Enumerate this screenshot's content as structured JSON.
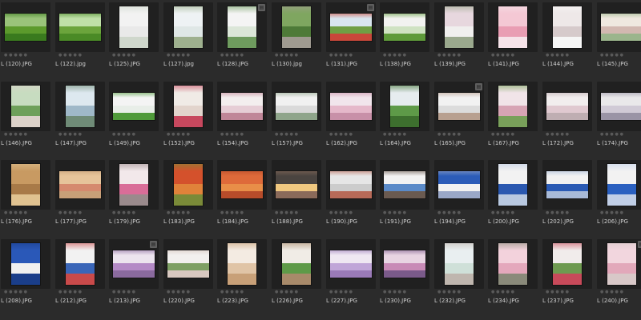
{
  "browser": {
    "items": [
      {
        "filename": "L (120).JPG",
        "orient": "l",
        "stacked": false,
        "stars": 0,
        "palette": [
          "#9ac37a",
          "#5c9a2c",
          "#3a7a1e"
        ]
      },
      {
        "filename": "L (122).jpg",
        "orient": "l",
        "stacked": false,
        "stars": 0,
        "palette": [
          "#bfe0a8",
          "#6ba43c",
          "#4a8a26"
        ]
      },
      {
        "filename": "L (125).JPG",
        "orient": "p",
        "stacked": false,
        "stars": 0,
        "palette": [
          "#f2f2f2",
          "#e9e9e9",
          "#cfd7cc"
        ]
      },
      {
        "filename": "L (127).jpg",
        "orient": "p",
        "stacked": false,
        "stars": 0,
        "palette": [
          "#eef2f4",
          "#dfe7e6",
          "#9eb08e"
        ]
      },
      {
        "filename": "L (128).JPG",
        "orient": "p",
        "stacked": true,
        "stars": 0,
        "palette": [
          "#f4f4f4",
          "#dbe6d8",
          "#6e9b5e"
        ]
      },
      {
        "filename": "L (130).jpg",
        "orient": "p",
        "stacked": false,
        "stars": 0,
        "palette": [
          "#7fa660",
          "#4e7a38",
          "#9f9a90"
        ]
      },
      {
        "filename": "L (131).JPG",
        "orient": "l",
        "stacked": true,
        "stars": 0,
        "palette": [
          "#d9e6ef",
          "#6f9f44",
          "#c9473a"
        ]
      },
      {
        "filename": "L (138).JPG",
        "orient": "l",
        "stacked": false,
        "stars": 0,
        "palette": [
          "#f2f2f0",
          "#cfe2c2",
          "#5e9a3a"
        ]
      },
      {
        "filename": "L (139).JPG",
        "orient": "p",
        "stacked": false,
        "stars": 0,
        "palette": [
          "#e7d7de",
          "#f0efee",
          "#9aa88d"
        ]
      },
      {
        "filename": "L (141).JPG",
        "orient": "p",
        "stacked": false,
        "stars": 0,
        "palette": [
          "#f4c8d4",
          "#e99db3",
          "#f6e3e9"
        ]
      },
      {
        "filename": "L (144).JPG",
        "orient": "p",
        "stacked": false,
        "stars": 0,
        "palette": [
          "#eee8e8",
          "#d6cacb",
          "#f6f6f6"
        ]
      },
      {
        "filename": "L (145).JPG",
        "orient": "l",
        "stacked": false,
        "stars": 0,
        "palette": [
          "#efe8df",
          "#d2b8b0",
          "#9bb58c"
        ]
      },
      {
        "filename": "L (146).JPG",
        "orient": "p",
        "stacked": false,
        "stars": 0,
        "palette": [
          "#c7dcc0",
          "#6ea05a",
          "#dcd2c9"
        ]
      },
      {
        "filename": "L (147).JPG",
        "orient": "p",
        "stacked": false,
        "stars": 0,
        "palette": [
          "#dde8ef",
          "#9fb8c8",
          "#6f8b77"
        ]
      },
      {
        "filename": "L (149).JPG",
        "orient": "l",
        "stacked": false,
        "stars": 0,
        "palette": [
          "#f4f4f4",
          "#e8eee8",
          "#4f9a3a"
        ]
      },
      {
        "filename": "L (152).JPG",
        "orient": "p",
        "stacked": false,
        "stars": 0,
        "palette": [
          "#f0ebe6",
          "#e2d4cc",
          "#c7485e"
        ]
      },
      {
        "filename": "L (154).JPG",
        "orient": "l",
        "stacked": false,
        "stars": 0,
        "palette": [
          "#f3eeee",
          "#e6cdd5",
          "#c08698"
        ]
      },
      {
        "filename": "L (157).JPG",
        "orient": "l",
        "stacked": false,
        "stars": 0,
        "palette": [
          "#f1f1f1",
          "#dadada",
          "#8fa58b"
        ]
      },
      {
        "filename": "L (162).JPG",
        "orient": "l",
        "stacked": false,
        "stars": 0,
        "palette": [
          "#f1e5ec",
          "#e5b8ca",
          "#c890a8"
        ]
      },
      {
        "filename": "L (164).JPG",
        "orient": "p",
        "stacked": false,
        "stars": 0,
        "palette": [
          "#e6ecef",
          "#5e9a48",
          "#3d6f2e"
        ]
      },
      {
        "filename": "L (165).JPG",
        "orient": "l",
        "stacked": true,
        "stars": 0,
        "palette": [
          "#f2f2f2",
          "#dcdcdc",
          "#b8a090"
        ]
      },
      {
        "filename": "L (167).JPG",
        "orient": "p",
        "stacked": false,
        "stars": 0,
        "palette": [
          "#f1e4e8",
          "#d7a4b4",
          "#79a05a"
        ]
      },
      {
        "filename": "L (172).JPG",
        "orient": "l",
        "stacked": false,
        "stars": 0,
        "palette": [
          "#f2eeee",
          "#e0c9d0",
          "#bfaeb2"
        ]
      },
      {
        "filename": "L (174).JPG",
        "orient": "l",
        "stacked": false,
        "stars": 0,
        "palette": [
          "#e9e8ea",
          "#d0cad6",
          "#9a94a6"
        ]
      },
      {
        "filename": "L (176).JPG",
        "orient": "p",
        "stacked": false,
        "stars": 0,
        "palette": [
          "#c89a62",
          "#a87a48",
          "#e0c290"
        ]
      },
      {
        "filename": "L (177).JPG",
        "orient": "l",
        "stacked": false,
        "stars": 0,
        "palette": [
          "#e6c49a",
          "#d58a6e",
          "#c8a078"
        ]
      },
      {
        "filename": "L (179).JPG",
        "orient": "p",
        "stacked": false,
        "stars": 0,
        "palette": [
          "#f2e8ea",
          "#d96d98",
          "#9a8a8c"
        ]
      },
      {
        "filename": "L (183).JPG",
        "orient": "p",
        "stacked": false,
        "stars": 0,
        "palette": [
          "#d4512c",
          "#e0823a",
          "#7a8a38"
        ]
      },
      {
        "filename": "L (184).JPG",
        "orient": "l",
        "stacked": false,
        "stars": 0,
        "palette": [
          "#de6a3a",
          "#e88e48",
          "#b84c2a"
        ]
      },
      {
        "filename": "L (188).JPG",
        "orient": "l",
        "stacked": false,
        "stars": 0,
        "palette": [
          "#4a4440",
          "#f0c880",
          "#8a6a5a"
        ]
      },
      {
        "filename": "L (190).JPG",
        "orient": "l",
        "stacked": false,
        "stars": 0,
        "palette": [
          "#e6e6e6",
          "#cccccc",
          "#b86a58"
        ]
      },
      {
        "filename": "L (191).JPG",
        "orient": "l",
        "stacked": false,
        "stars": 0,
        "palette": [
          "#f2f2f2",
          "#5a8ac8",
          "#6a5a50"
        ]
      },
      {
        "filename": "L (194).JPG",
        "orient": "l",
        "stacked": false,
        "stars": 0,
        "palette": [
          "#2c5cb8",
          "#f2f2f2",
          "#9aa8c8"
        ]
      },
      {
        "filename": "L (200).JPG",
        "orient": "p",
        "stacked": false,
        "stars": 0,
        "palette": [
          "#f2f2f2",
          "#2a58b0",
          "#b8c8e0"
        ]
      },
      {
        "filename": "L (202).JPG",
        "orient": "l",
        "stacked": false,
        "stars": 0,
        "palette": [
          "#f1f1f1",
          "#2a5ab4",
          "#a8bad8"
        ]
      },
      {
        "filename": "L (206).JPG",
        "orient": "p",
        "stacked": false,
        "stars": 0,
        "palette": [
          "#f2f2f2",
          "#2a60c0",
          "#c0cee6"
        ]
      },
      {
        "filename": "L (208).JPG",
        "orient": "p",
        "stacked": false,
        "stars": 0,
        "palette": [
          "#2a58b8",
          "#f0f0f0",
          "#1a3e8a"
        ]
      },
      {
        "filename": "L (212).JPG",
        "orient": "p",
        "stacked": false,
        "stars": 0,
        "palette": [
          "#f2f2f2",
          "#3a66b8",
          "#c94a4a"
        ]
      },
      {
        "filename": "L (213).JPG",
        "orient": "l",
        "stacked": true,
        "stars": 0,
        "palette": [
          "#ece4ee",
          "#b48ac6",
          "#8a6a9e"
        ]
      },
      {
        "filename": "L (220).JPG",
        "orient": "l",
        "stacked": false,
        "stars": 0,
        "palette": [
          "#f2f0ee",
          "#7ea064",
          "#d8c8c0"
        ]
      },
      {
        "filename": "L (223).JPG",
        "orient": "p",
        "stacked": false,
        "stars": 0,
        "palette": [
          "#f4ebe2",
          "#e0c4a6",
          "#c8a078"
        ]
      },
      {
        "filename": "L (226).JPG",
        "orient": "p",
        "stacked": false,
        "stars": 0,
        "palette": [
          "#f0ece6",
          "#5e9a48",
          "#a88a6a"
        ]
      },
      {
        "filename": "L (227).JPG",
        "orient": "l",
        "stacked": false,
        "stars": 0,
        "palette": [
          "#efe8f2",
          "#c0a6d8",
          "#9a7ab8"
        ]
      },
      {
        "filename": "L (230).JPG",
        "orient": "l",
        "stacked": false,
        "stars": 0,
        "palette": [
          "#e8d4e2",
          "#c88ab6",
          "#7a5a8a"
        ]
      },
      {
        "filename": "L (232).JPG",
        "orient": "p",
        "stacked": false,
        "stars": 0,
        "palette": [
          "#e9eff0",
          "#cfe0d8",
          "#bfb6ae"
        ]
      },
      {
        "filename": "L (234).JPG",
        "orient": "p",
        "stacked": false,
        "stars": 0,
        "palette": [
          "#f3d2dc",
          "#e4a8bc",
          "#8a8a7a"
        ]
      },
      {
        "filename": "L (237).JPG",
        "orient": "p",
        "stacked": false,
        "stars": 0,
        "palette": [
          "#f1eceb",
          "#6e9a50",
          "#c84a5a"
        ]
      },
      {
        "filename": "L (240).JPG",
        "orient": "p",
        "stacked": true,
        "stars": 0,
        "palette": [
          "#f2d6de",
          "#e2a8ba",
          "#d8c8c8"
        ]
      }
    ]
  }
}
